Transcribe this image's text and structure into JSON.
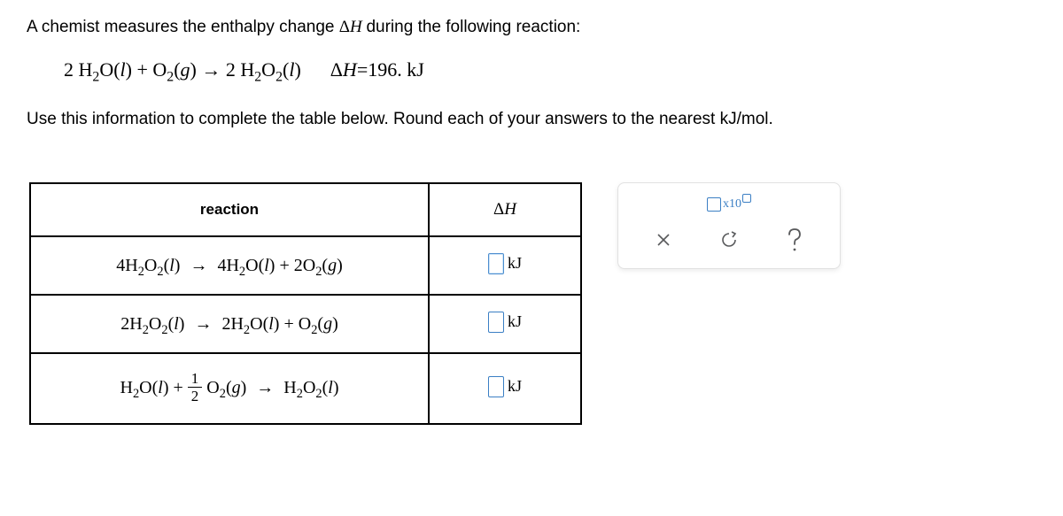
{
  "prompt1_prefix": "A chemist measures the enthalpy change ",
  "prompt1_delta": "Δ",
  "prompt1_H": "H",
  "prompt1_suffix": " during the following reaction:",
  "given_reaction": {
    "lhs": "2 H<sub>2</sub>O(<i>l</i>) + O<sub>2</sub>(<i>g</i>)",
    "arrow": "→",
    "rhs": "2 H<sub>2</sub>O<sub>2</sub>(<i>l</i>)",
    "dh_label": "ΔH=196. kJ"
  },
  "prompt2": "Use this information to complete the table below. Round each of your answers to the nearest kJ/mol.",
  "table": {
    "header_reaction": "reaction",
    "header_dh_delta": "Δ",
    "header_dh_H": "H",
    "rows": [
      {
        "formula": "4H<sub>2</sub>O<sub>2</sub>(<i>l</i>) <span class=\"arrow\">→</span> 4H<sub>2</sub>O(<i>l</i>) + 2O<sub>2</sub>(<i>g</i>)",
        "unit": "kJ",
        "input_active": true
      },
      {
        "formula": "2H<sub>2</sub>O<sub>2</sub>(<i>l</i>) <span class=\"arrow\">→</span> 2H<sub>2</sub>O(<i>l</i>) + O<sub>2</sub>(<i>g</i>)",
        "unit": "kJ",
        "input_active": false
      },
      {
        "formula": "H<sub>2</sub>O(<i>l</i>) + <span class=\"frac\"><span class=\"num\">1</span><span class=\"den\">2</span></span> O<sub>2</sub>(<i>g</i>) <span class=\"arrow\">→</span> H<sub>2</sub>O<sub>2</sub>(<i>l</i>)",
        "unit": "kJ",
        "input_active": false,
        "tall": true
      }
    ]
  },
  "toolbar": {
    "sci_label": "x10",
    "close_name": "close",
    "reset_name": "reset",
    "help_name": "help"
  }
}
